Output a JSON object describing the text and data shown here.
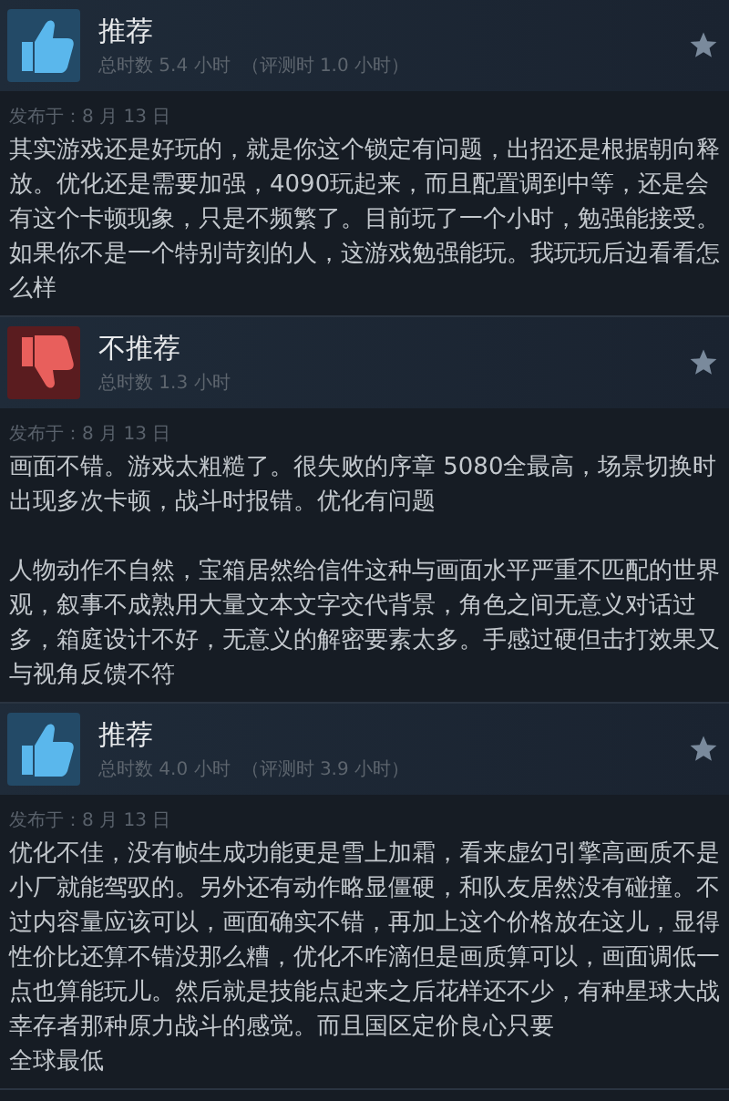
{
  "reviews": [
    {
      "recommended": true,
      "verdict": "推荐",
      "hours": "总时数 5.4 小时",
      "review_hours": "（评测时 1.0 小时）",
      "posted": "发布于：8 月 13 日",
      "paragraphs": [
        "其实游戏还是好玩的，就是你这个锁定有问题，出招还是根据朝向释放。优化还是需要加强，4090玩起来，而且配置调到中等，还是会有这个卡顿现象，只是不频繁了。目前玩了一个小时，勉强能接受。如果你不是一个特别苛刻的人，这游戏勉强能玩。我玩玩后边看看怎么样"
      ]
    },
    {
      "recommended": false,
      "verdict": "不推荐",
      "hours": "总时数 1.3 小时",
      "posted": "发布于：8 月 13 日",
      "paragraphs": [
        "画面不错。游戏太粗糙了。很失败的序章 5080全最高，场景切换时出现多次卡顿，战斗时报错。优化有问题",
        "人物动作不自然，宝箱居然给信件这种与画面水平严重不匹配的世界观，叙事不成熟用大量文本文字交代背景，角色之间无意义对话过多，箱庭设计不好，无意义的解密要素太多。手感过硬但击打效果又与视角反馈不符"
      ]
    },
    {
      "recommended": true,
      "verdict": "推荐",
      "hours": "总时数 4.0 小时",
      "review_hours": "（评测时 3.9 小时）",
      "posted": "发布于：8 月 13 日",
      "paragraphs": [
        "优化不佳，没有帧生成功能更是雪上加霜，看来虚幻引擎高画质不是小厂就能驾驭的。另外还有动作略显僵硬，和队友居然没有碰撞。不过内容量应该可以，画面确实不错，再加上这个价格放在这儿，显得性价比还算不错没那么糟，优化不咋滴但是画质算可以，画面调低一点也算能玩儿。然后就是技能点起来之后花样还不少，有种星球大战幸存者那种原力战斗的感觉。而且国区定价良心只要",
        "全球最低"
      ]
    }
  ]
}
